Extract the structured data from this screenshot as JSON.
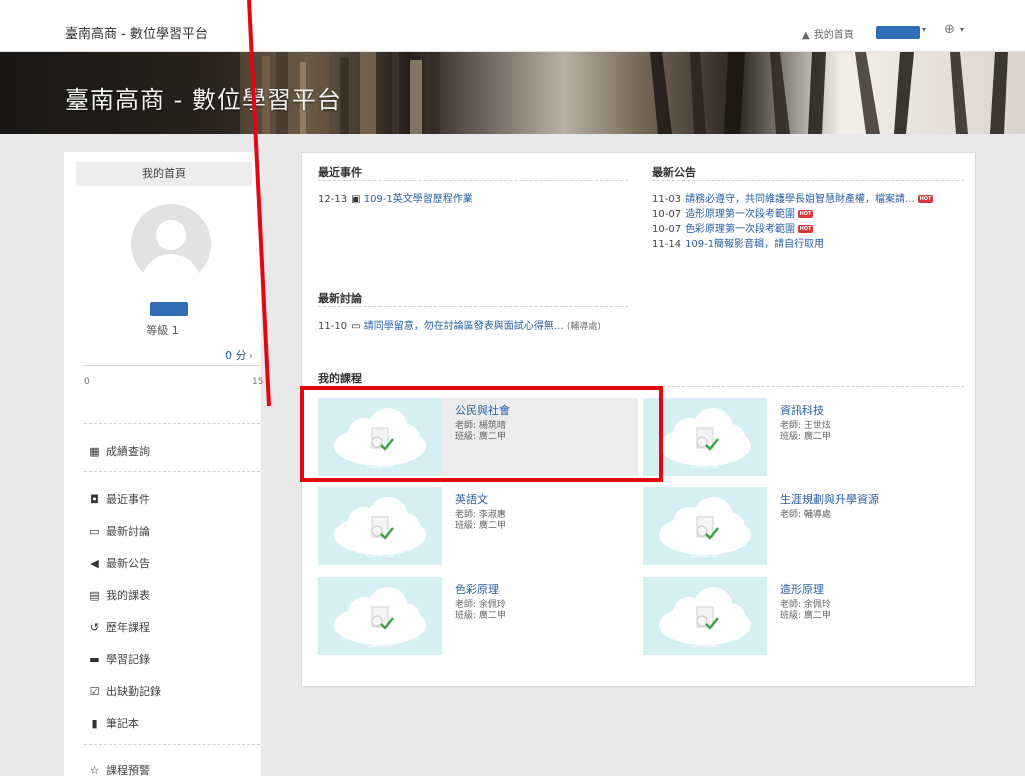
{
  "header": {
    "site_title": "臺南高商 - 數位學習平台",
    "home_link": "我的首頁",
    "user_caret": "▾",
    "globe_caret": "▾"
  },
  "banner": {
    "title": "臺南高商 - 數位學習平台"
  },
  "sidebar": {
    "header": "我的首頁",
    "level": "等級 1",
    "points": "0 分",
    "progress": {
      "value": 0,
      "min": "0",
      "max": "15"
    },
    "menu_groups": [
      [
        {
          "icon": "calculator-icon",
          "glyph": "▦",
          "label": "成績查詢"
        }
      ],
      [
        {
          "icon": "calendar-event-icon",
          "glyph": "◘",
          "label": "最近事件"
        },
        {
          "icon": "comment-icon",
          "glyph": "▭",
          "label": "最新討論"
        },
        {
          "icon": "bullhorn-icon",
          "glyph": "◀",
          "label": "最新公告"
        },
        {
          "icon": "calendar-icon",
          "glyph": "▤",
          "label": "我的課表"
        },
        {
          "icon": "history-icon",
          "glyph": "↺",
          "label": "歷年課程"
        },
        {
          "icon": "record-icon",
          "glyph": "▬",
          "label": "學習記錄"
        },
        {
          "icon": "attendance-icon",
          "glyph": "☑",
          "label": "出缺勤記錄"
        },
        {
          "icon": "notebook-icon",
          "glyph": "▮",
          "label": "筆記本"
        }
      ],
      [
        {
          "icon": "star-icon",
          "glyph": "☆",
          "label": "課程預警"
        }
      ]
    ]
  },
  "main": {
    "recent_events": {
      "title": "最近事件",
      "items": [
        {
          "date": "12-13",
          "text": "109-1英文學習歷程作業"
        }
      ]
    },
    "announcements": {
      "title": "最新公告",
      "hot_label": "HOT",
      "items": [
        {
          "date": "11-03",
          "text": "請務必遵守，共同維護學長姐智慧財產權，檔案請…",
          "hot": true
        },
        {
          "date": "10-07",
          "text": "造形原理第一次段考範圍",
          "hot": true
        },
        {
          "date": "10-07",
          "text": "色彩原理第一次段考範圍",
          "hot": true
        },
        {
          "date": "11-14",
          "text": "109-1簡報影音輯，請自行取用",
          "hot": false
        }
      ]
    },
    "discussions": {
      "title": "最新討論",
      "items": [
        {
          "date": "11-10",
          "text": "請同學留意，勿在討論區發表與面試心得無…",
          "source": "(輔導處)"
        }
      ]
    },
    "my_courses": {
      "title": "我的課程",
      "thumb_label": "Course",
      "courses": [
        {
          "name": "公民與社會",
          "teacher": "老師: 楊筑晴",
          "class": "班級: 廣二甲"
        },
        {
          "name": "資訊科技",
          "teacher": "老師: 王世炫",
          "class": "班級: 廣二甲"
        },
        {
          "name": "英語文",
          "teacher": "老師: 李淑惠",
          "class": "班級: 廣二甲"
        },
        {
          "name": "生涯規劃與升學資源",
          "teacher": "老師: 輔導處",
          "class": ""
        },
        {
          "name": "色彩原理",
          "teacher": "老師: 余佩玲",
          "class": "班級: 廣二甲"
        },
        {
          "name": "造形原理",
          "teacher": "老師: 余佩玲",
          "class": "班級: 廣二甲"
        }
      ]
    }
  },
  "colors": {
    "accent": "#2f6db5",
    "link": "#2b5fa6",
    "hot": "#d9383a",
    "thumb_bg": "#d6eff3",
    "annotation": "#e30613"
  }
}
